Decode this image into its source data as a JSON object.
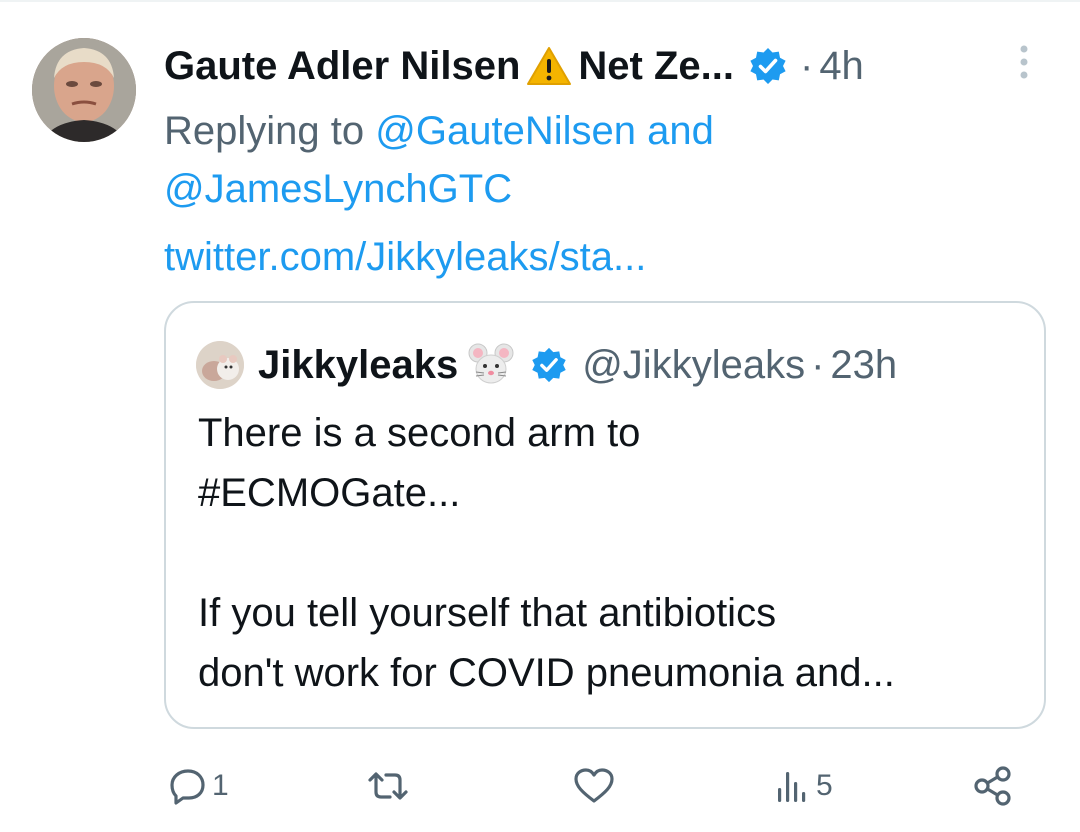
{
  "tweet": {
    "author_name": "Gaute Adler Nilsen",
    "name_suffix": "Net Ze...",
    "separator": "·",
    "time": "4h",
    "reply_prefix": "Replying to",
    "reply_mentions": "@GauteNilsen and",
    "reply_mentions_2": "@JamesLynchGTC",
    "link": "twitter.com/Jikkyleaks/sta..."
  },
  "quote": {
    "name": "Jikkyleaks",
    "handle": "@Jikkyleaks",
    "separator": "·",
    "time": "23h",
    "body": "There is a second arm to\n#ECMOGate...\n\nIf you tell yourself that antibiotics\ndon't work for COVID pneumonia and..."
  },
  "actions": {
    "reply_count": "1",
    "retweet_count": "",
    "like_count": "",
    "views_count": "5"
  },
  "icons": {
    "warning": "warning-icon",
    "verified": "verified-badge-icon",
    "more": "more-vertical-icon",
    "mouse": "mouse-face-icon",
    "reply": "reply-icon",
    "retweet": "retweet-icon",
    "like": "heart-icon",
    "views": "views-icon",
    "share": "share-icon"
  },
  "colors": {
    "accent": "#1d9bf0",
    "secondary_text": "#536471",
    "primary_text": "#0f1419",
    "border": "#cfd9de"
  }
}
